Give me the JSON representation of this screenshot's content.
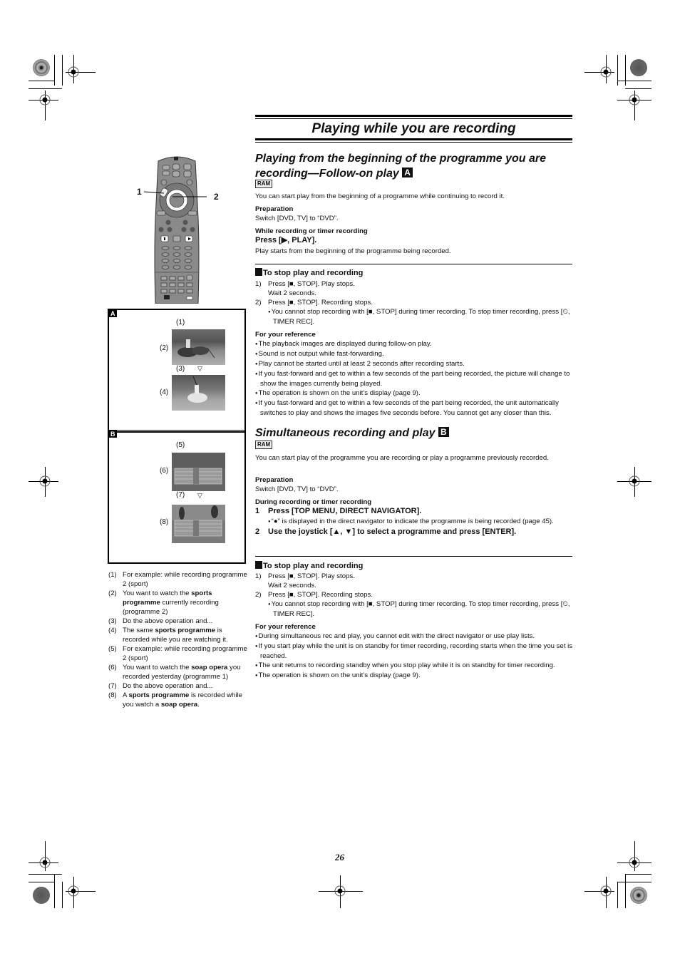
{
  "page": {
    "title": "Playing while you are recording",
    "page_number": "26"
  },
  "section_a": {
    "heading_line1": "Playing from the beginning of the programme you are",
    "heading_line2": "recording—Follow-on play",
    "tag": "A",
    "disc_badge": "RAM",
    "intro": "You can start play from the beginning of a programme while continuing to record it.",
    "prep_label": "Preparation",
    "prep_text": "Switch [DVD, TV] to “DVD”.",
    "condition": "While recording or timer recording",
    "action": "Press [▶, PLAY].",
    "action_result": "Play starts from the beginning of the programme being recorded.",
    "stop_heading": "To stop play and recording",
    "stop_steps": [
      {
        "num": "1)",
        "text": "Press [■, STOP]. Play stops.",
        "sub": "Wait 2 seconds."
      },
      {
        "num": "2)",
        "text": "Press [■, STOP]. Recording stops.",
        "note": "You cannot stop recording with [■, STOP] during timer recording. To stop timer recording, press [⏲, TIMER REC]."
      }
    ],
    "ref_label": "For your reference",
    "ref_items": [
      "The playback images are displayed during follow-on play.",
      "Sound is not output while fast-forwarding.",
      "Play cannot be started until at least 2 seconds after recording starts.",
      "If you fast-forward and get to within a few seconds of the part being recorded, the picture will change to show the images currently being played.",
      "The operation is shown on the unit’s display (page 9).",
      "If you fast-forward and get to within a few seconds of the part being recorded, the unit automatically switches to play and shows the images five seconds before. You cannot get any closer than this."
    ]
  },
  "section_b": {
    "heading": "Simultaneous recording and play",
    "tag": "B",
    "disc_badge": "RAM",
    "intro": "You can start play of the programme you are recording or play a programme previously recorded.",
    "prep_label": "Preparation",
    "prep_text": "Switch [DVD, TV] to “DVD”.",
    "condition": "During recording or timer recording",
    "steps": [
      {
        "num": "1",
        "text": "Press [TOP MENU, DIRECT NAVIGATOR].",
        "note": "“●” is displayed in the direct navigator to indicate the programme is being recorded (page 45)."
      },
      {
        "num": "2",
        "text": "Use the joystick [▲, ▼] to select a programme and press [ENTER]."
      }
    ],
    "stop_heading": "To stop play and recording",
    "stop_steps": [
      {
        "num": "1)",
        "text": "Press [■, STOP]. Play stops.",
        "sub": "Wait 2 seconds."
      },
      {
        "num": "2)",
        "text": "Press [■, STOP]. Recording stops.",
        "note": "You cannot stop recording with [■, STOP] during timer recording. To stop timer recording, press [⏲, TIMER REC]."
      }
    ],
    "ref_label": "For your reference",
    "ref_items": [
      "During simultaneous rec and play, you cannot edit with the direct navigator or use play lists.",
      "If you start play while the unit is on standby for timer recording, recording starts when the time you set is reached.",
      "The unit returns to recording standby when you stop play while it is on standby for timer recording.",
      "The operation is shown on the unit’s display (page 9)."
    ]
  },
  "remote": {
    "callout_1": "1",
    "callout_2": "2",
    "stop_label": "STOP",
    "pause_label": "PAUSE",
    "play_label": "PLAY"
  },
  "figure_a": {
    "tag": "A",
    "labels": [
      "(1)",
      "(2)",
      "(3)",
      "(4)"
    ],
    "arrow": "▽"
  },
  "figure_b": {
    "tag": "B",
    "labels": [
      "(5)",
      "(6)",
      "(7)",
      "(8)"
    ],
    "arrow": "▽"
  },
  "captions": [
    {
      "num": "(1)",
      "html": "For example:  while recording programme 2 (sport)"
    },
    {
      "num": "(2)",
      "html": "You want to watch the <b>sports programme</b> currently recording (programme 2)"
    },
    {
      "num": "(3)",
      "html": "Do the above operation and..."
    },
    {
      "num": "(4)",
      "html": "The same <b>sports programme</b> is recorded while you are watching it."
    },
    {
      "num": "(5)",
      "html": "For example:  while recording programme 2 (sport)"
    },
    {
      "num": "(6)",
      "html": "You want to watch the <b>soap opera</b> you recorded yesterday (programme 1)"
    },
    {
      "num": "(7)",
      "html": "Do the above operation and..."
    },
    {
      "num": "(8)",
      "html": "A <b>sports programme</b> is recorded while you watch a <b>soap opera</b>."
    }
  ]
}
